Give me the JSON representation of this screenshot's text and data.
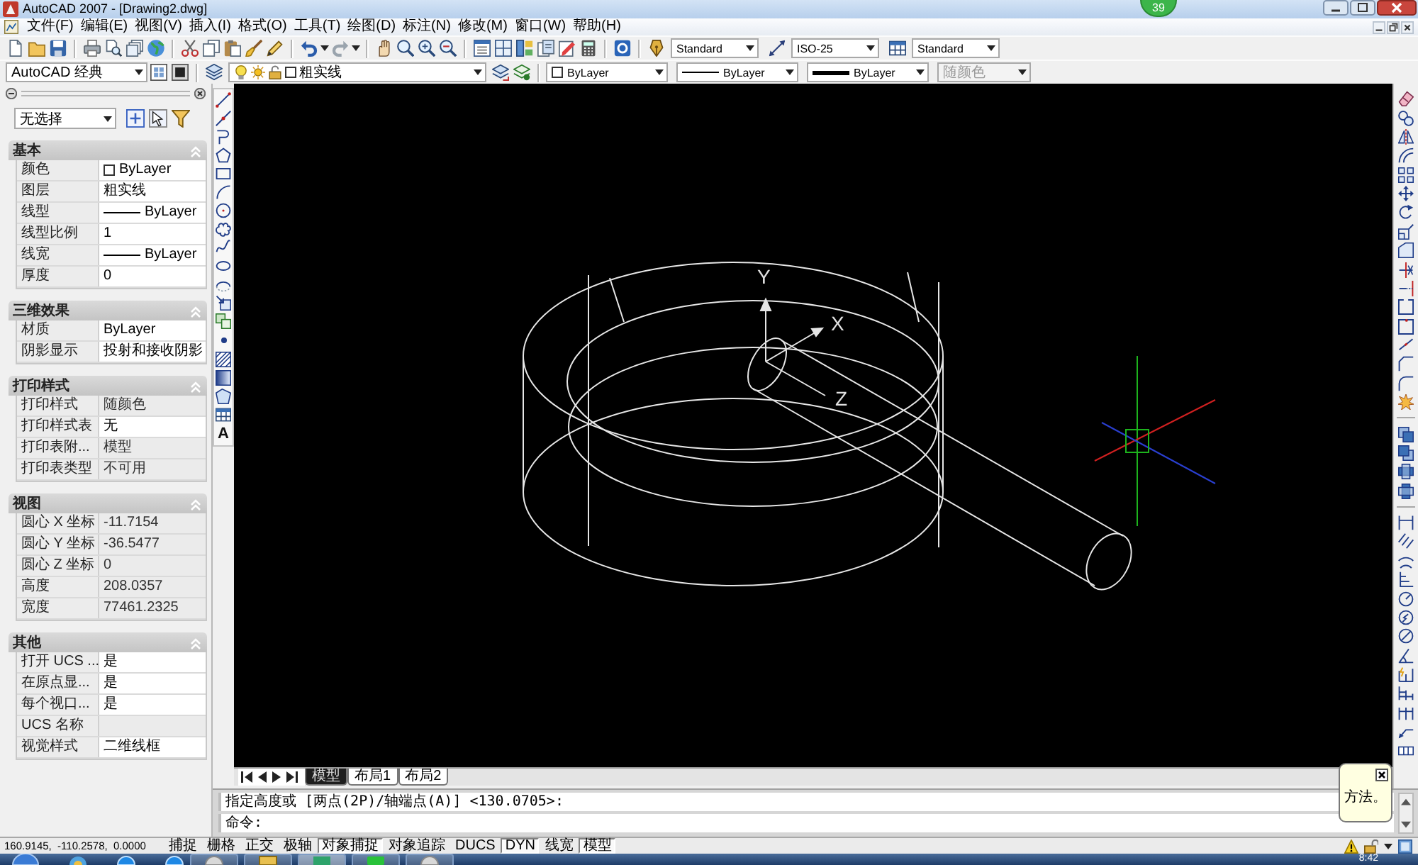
{
  "window": {
    "title": "AutoCAD 2007 - [Drawing2.dwg]",
    "notification_badge": "39"
  },
  "menu_bar": [
    "文件(F)",
    "编辑(E)",
    "视图(V)",
    "插入(I)",
    "格式(O)",
    "工具(T)",
    "绘图(D)",
    "标注(N)",
    "修改(M)",
    "窗口(W)",
    "帮助(H)"
  ],
  "styles_toolbar": [
    {
      "kind": "text",
      "value": "Standard"
    },
    {
      "kind": "dimension",
      "value": "ISO-25"
    },
    {
      "kind": "table",
      "value": "Standard"
    }
  ],
  "workspaces_toolbar": {
    "workspace": "AutoCAD 经典"
  },
  "layers_toolbar": {
    "layer": "粗实线"
  },
  "properties_toolbar": [
    {
      "kind": "color",
      "value": "ByLayer",
      "disabled": false
    },
    {
      "kind": "linetype",
      "value": "ByLayer",
      "disabled": false
    },
    {
      "kind": "lineweight",
      "value": "ByLayer",
      "disabled": false
    },
    {
      "kind": "plot_style",
      "value": "随颜色",
      "disabled": true
    }
  ],
  "properties_palette": {
    "selection": "无选择",
    "sections": [
      {
        "title": "基本",
        "expanded": true,
        "rows": [
          {
            "label": "颜色",
            "value": "ByLayer",
            "kind": "swatch",
            "readonly": false
          },
          {
            "label": "图层",
            "value": "粗实线",
            "kind": "text",
            "readonly": false
          },
          {
            "label": "线型",
            "value": "ByLayer",
            "kind": "line",
            "readonly": false
          },
          {
            "label": "线型比例",
            "value": "1",
            "kind": "text",
            "readonly": false
          },
          {
            "label": "线宽",
            "value": "ByLayer",
            "kind": "line",
            "readonly": false
          },
          {
            "label": "厚度",
            "value": "0",
            "kind": "text",
            "readonly": false
          }
        ]
      },
      {
        "title": "三维效果",
        "expanded": true,
        "rows": [
          {
            "label": "材质",
            "value": "ByLayer",
            "kind": "text",
            "readonly": false
          },
          {
            "label": "阴影显示",
            "value": "投射和接收阴影",
            "kind": "text",
            "readonly": false
          }
        ]
      },
      {
        "title": "打印样式",
        "expanded": true,
        "rows": [
          {
            "label": "打印样式",
            "value": "随颜色",
            "kind": "text",
            "readonly": true
          },
          {
            "label": "打印样式表",
            "value": "无",
            "kind": "text",
            "readonly": false
          },
          {
            "label": "打印表附...",
            "value": "模型",
            "kind": "text",
            "readonly": true
          },
          {
            "label": "打印表类型",
            "value": "不可用",
            "kind": "text",
            "readonly": true
          }
        ]
      },
      {
        "title": "视图",
        "expanded": true,
        "rows": [
          {
            "label": "圆心 X 坐标",
            "value": "-11.7154",
            "kind": "text",
            "readonly": true
          },
          {
            "label": "圆心 Y 坐标",
            "value": "-36.5477",
            "kind": "text",
            "readonly": true
          },
          {
            "label": "圆心 Z 坐标",
            "value": "0",
            "kind": "text",
            "readonly": true
          },
          {
            "label": "高度",
            "value": "208.0357",
            "kind": "text",
            "readonly": true
          },
          {
            "label": "宽度",
            "value": "77461.2325",
            "kind": "text",
            "readonly": true
          }
        ]
      },
      {
        "title": "其他",
        "expanded": true,
        "rows": [
          {
            "label": "打开 UCS ...",
            "value": "是",
            "kind": "text",
            "readonly": false
          },
          {
            "label": "在原点显...",
            "value": "是",
            "kind": "text",
            "readonly": false
          },
          {
            "label": "每个视口...",
            "value": "是",
            "kind": "text",
            "readonly": false
          },
          {
            "label": "UCS 名称",
            "kind": "text",
            "readonly": true
          },
          {
            "label": "视觉样式",
            "value": "二维线框",
            "kind": "text",
            "readonly": false
          }
        ]
      }
    ]
  },
  "draw_toolbar": {
    "text_tool": "A"
  },
  "drawing": {
    "axis_labels": [
      "Y",
      "X",
      "Z"
    ]
  },
  "layout_tabs": [
    {
      "label": "模型",
      "selected": true
    },
    {
      "label": "布局1",
      "selected": false
    },
    {
      "label": "布局2",
      "selected": false
    }
  ],
  "command_window": {
    "history": "指定高度或 [两点(2P)/轴端点(A)] <130.0705>:",
    "prompt": "命令:"
  },
  "balloon": {
    "text": "方法。"
  },
  "status_bar": {
    "coordinates": "160.9145,  -110.2578,  0.0000",
    "toggles": [
      {
        "label": "捕捉",
        "on": false
      },
      {
        "label": "栅格",
        "on": false
      },
      {
        "label": "正交",
        "on": false
      },
      {
        "label": "极轴",
        "on": false
      },
      {
        "label": "对象捕捉",
        "on": true
      },
      {
        "label": "对象追踪",
        "on": false
      },
      {
        "label": "DUCS",
        "on": false
      },
      {
        "label": "DYN",
        "on": true
      },
      {
        "label": "线宽",
        "on": false
      },
      {
        "label": "模型",
        "on": true
      }
    ]
  },
  "taskbar": {
    "clock": "8:42"
  }
}
